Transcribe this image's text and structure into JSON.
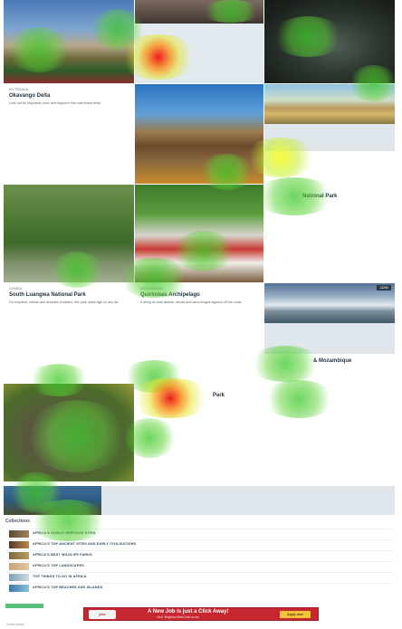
{
  "cards": {
    "okavango": {
      "label": "Botswana",
      "title": "Okavango Delta",
      "text": "Look out for elephants, lions and hippos in this vast inland delta."
    },
    "south_luangwa": {
      "label": "Zambia",
      "title": "South Luangwa National Park",
      "text": "For leopards, zebras and decades of safaris, this park ranks high on any list."
    },
    "quirimbas": {
      "label": "Mozambique",
      "title": "Quirimbas Archipelago",
      "text": "A string of coral islands, dhows and sand-fringed lagoons off the coast."
    },
    "national_park": {
      "title": "National Park"
    },
    "falls": {
      "title": "& Mozambique"
    },
    "park": {
      "title": "Park"
    }
  },
  "badge": "13260",
  "collections": {
    "title": "Collections",
    "items": [
      "AFRICA'S WORLD HERITAGE SITES",
      "AFRICA'S TOP ANCIENT SITES AND EARLY CIVILISATIONS",
      "AFRICA'S BEST WILDLIFE PARKS",
      "AFRICA'S TOP LANDSCAPES",
      "TOP THINGS TO DO IN AFRICA",
      "AFRICA'S TOP BEACHES AND ISLANDS"
    ]
  },
  "ad": {
    "headline": "A New Job is just a Click Away!",
    "sub": "Visit: BrightonSkinCare.co.za",
    "cta": "Apply now"
  },
  "footer": "lonely planet"
}
